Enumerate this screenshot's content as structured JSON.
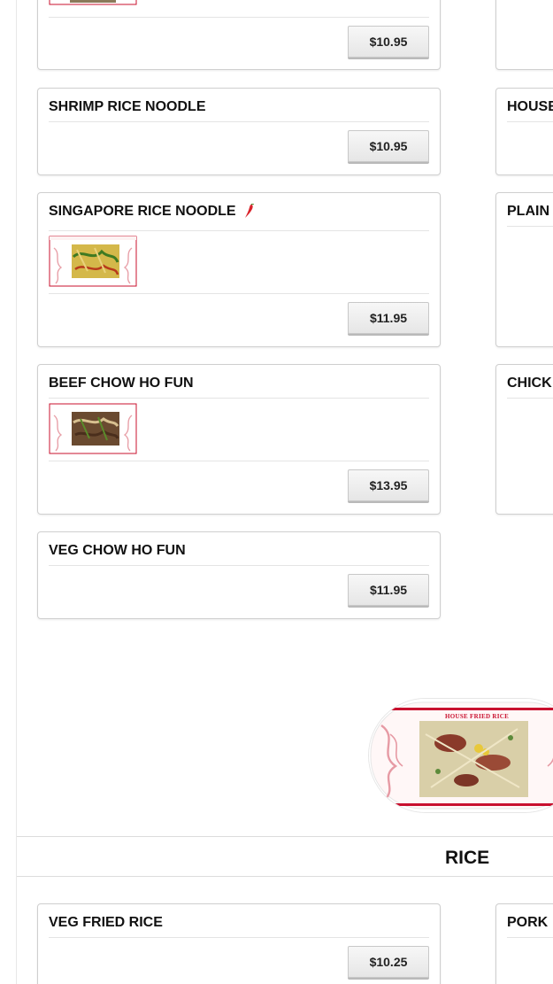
{
  "noodles": {
    "left_cards": [
      {
        "id": "top-partial",
        "title": "",
        "price": "$10.95",
        "has_image": true,
        "spicy": false
      },
      {
        "id": "shrimp-rice-noodle",
        "title": "SHRIMP RICE NOODLE",
        "price": "$10.95",
        "has_image": false,
        "spicy": false
      },
      {
        "id": "singapore-rice-noodle",
        "title": "SINGAPORE RICE NOODLE",
        "price": "$11.95",
        "has_image": true,
        "spicy": true
      },
      {
        "id": "beef-chow-ho-fun",
        "title": "BEEF CHOW HO FUN",
        "price": "$13.95",
        "has_image": true,
        "spicy": false
      },
      {
        "id": "veg-chow-ho-fun",
        "title": "VEG CHOW HO FUN",
        "price": "$11.95",
        "has_image": false,
        "spicy": false
      }
    ],
    "right_cards": [
      {
        "id": "right-top-partial",
        "title": ""
      },
      {
        "id": "right-house",
        "title": "HOUSE"
      },
      {
        "id": "right-plain",
        "title": "PLAIN"
      },
      {
        "id": "right-chick",
        "title": "CHICK"
      }
    ]
  },
  "featured": {
    "caption": "HOUSE FRIED RICE"
  },
  "rice_section": {
    "title": "RICE",
    "left_cards": [
      {
        "id": "veg-fried-rice",
        "title": "VEG FRIED RICE",
        "price": "$10.25"
      }
    ],
    "right_cards": [
      {
        "id": "right-pork",
        "title": "PORK"
      }
    ]
  },
  "colors": {
    "accent_red": "#c8102e",
    "card_border": "#cfcfcf",
    "button_bg": "#ececec"
  }
}
